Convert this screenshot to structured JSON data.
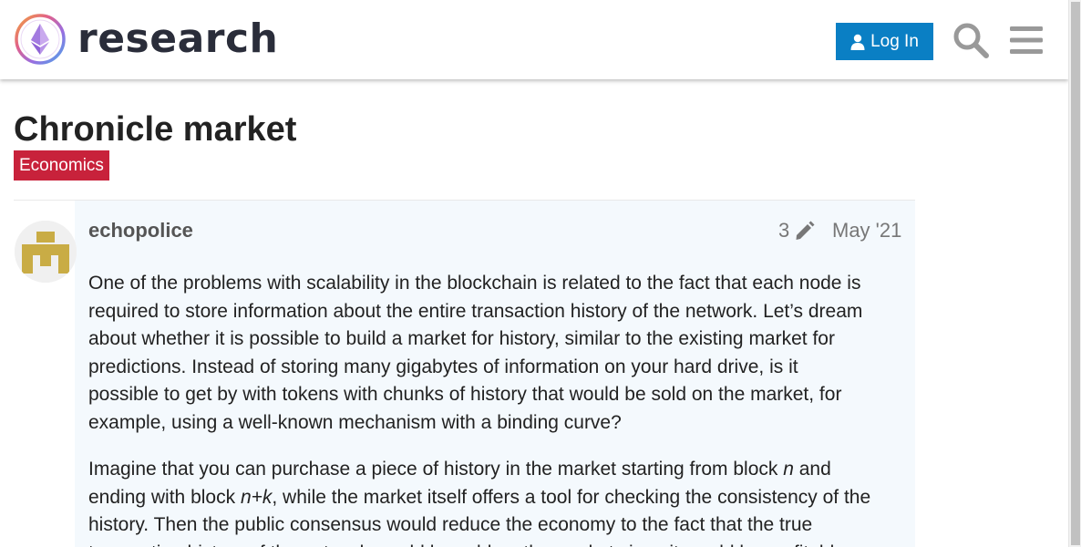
{
  "header": {
    "site_name": "research",
    "login_label": "Log In",
    "icons": [
      "ethereum-logo-icon",
      "user-icon",
      "search-icon",
      "hamburger-menu-icon"
    ]
  },
  "topic": {
    "title": "Chronicle market",
    "category": "Economics",
    "category_color": "#c8223b"
  },
  "post": {
    "username": "echopolice",
    "edit_count": "3",
    "date": "May '21",
    "paragraph1_lines": [
      "One of the problems with scalability in the blockchain is related to the fact that each node is",
      "required to store information about the entire transaction history of the network. Let’s dream",
      "about whether it is possible to build a market for history, similar to the existing market for",
      "predictions. Instead of storing many gigabytes of information on your hard drive, is it",
      "possible to get by with tokens with chunks of history that would be sold on the market, for",
      "example, using a well-known mechanism with a binding curve?"
    ],
    "paragraph2": {
      "l1_a": "Imagine that you can purchase a piece of history in the market starting from block ",
      "l1_n": "n",
      "l1_b": " and",
      "l2_a": "ending with block ",
      "l2_nk": "n+k",
      "l2_b": ", while the market itself offers a tool for checking the consistency of the",
      "l3": "history. Then the public consensus would reduce the economy to the fact that the true",
      "l4": "transaction history of the network would be sold on the market since it would be profitable"
    }
  },
  "colors": {
    "accent": "#0a7fc4",
    "post_background": "#f4f9fd"
  }
}
